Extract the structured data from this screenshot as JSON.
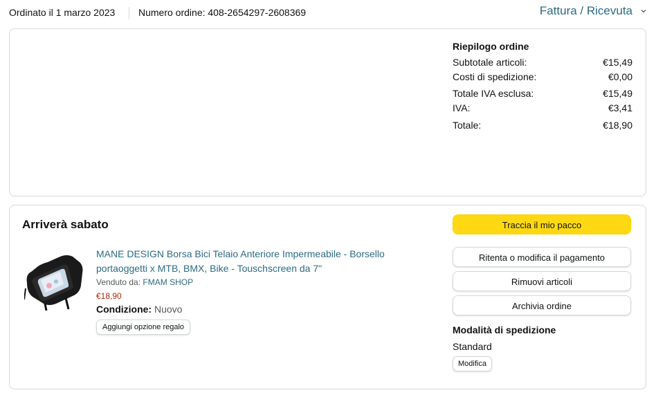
{
  "header": {
    "order_date": "Ordinato il 1 marzo 2023",
    "order_number": "Numero ordine: 408-2654297-2608369",
    "invoice_link": "Fattura / Ricevuta"
  },
  "summary": {
    "title": "Riepilogo ordine",
    "rows": [
      {
        "label": "Subtotale articoli:",
        "value": "€15,49"
      },
      {
        "label": "Costi di spedizione:",
        "value": "€0,00"
      },
      {
        "label": "Totale IVA esclusa:",
        "value": "€15,49"
      },
      {
        "label": "IVA:",
        "value": "€3,41"
      },
      {
        "label": "Totale:",
        "value": "€18,90"
      }
    ]
  },
  "shipment": {
    "arrival": "Arriverà sabato",
    "product": {
      "title": "MANE DESIGN Borsa Bici Telaio Anteriore Impermeabile - Borsello portaoggetti x MTB, BMX, Bike - Touschscreen da 7\"",
      "sold_by_label": "Venduto da:",
      "seller": "FMAM SHOP",
      "price": "€18,90",
      "condition_label": "Condizione:",
      "condition_value": "Nuovo",
      "gift_button": "Aggiungi opzione regalo"
    },
    "actions": {
      "track": "Traccia il mio pacco",
      "retry_payment": "Ritenta o modifica il pagamento",
      "remove_items": "Rimuovi articoli",
      "archive": "Archivia ordine"
    },
    "shipping": {
      "title": "Modalità di spedizione",
      "method": "Standard",
      "modify_button": "Modifica"
    }
  },
  "colors": {
    "link": "#2c6b83",
    "price": "#b12704",
    "primary_button": "#ffd814",
    "border": "#d5d9d9"
  }
}
